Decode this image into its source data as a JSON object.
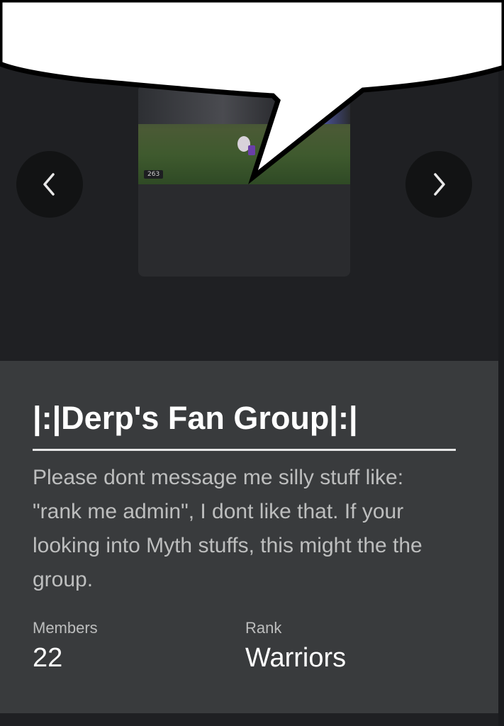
{
  "carousel": {
    "thumbnail_badge": "263",
    "prev_icon": "chevron-left-icon",
    "next_icon": "chevron-right-icon"
  },
  "group": {
    "name": "|:|Derp's Fan Group|:|",
    "description": "Please dont message me silly stuff like: \"rank me admin\", I dont like that. If your looking into Myth stuffs, this might the the group.",
    "members_label": "Members",
    "members_value": "22",
    "rank_label": "Rank",
    "rank_value": "Warriors"
  },
  "colors": {
    "background": "#1f2023",
    "panel": "#393b3d",
    "text_primary": "#ffffff",
    "text_secondary": "#bdbebe",
    "bubble": "#ffffff"
  }
}
